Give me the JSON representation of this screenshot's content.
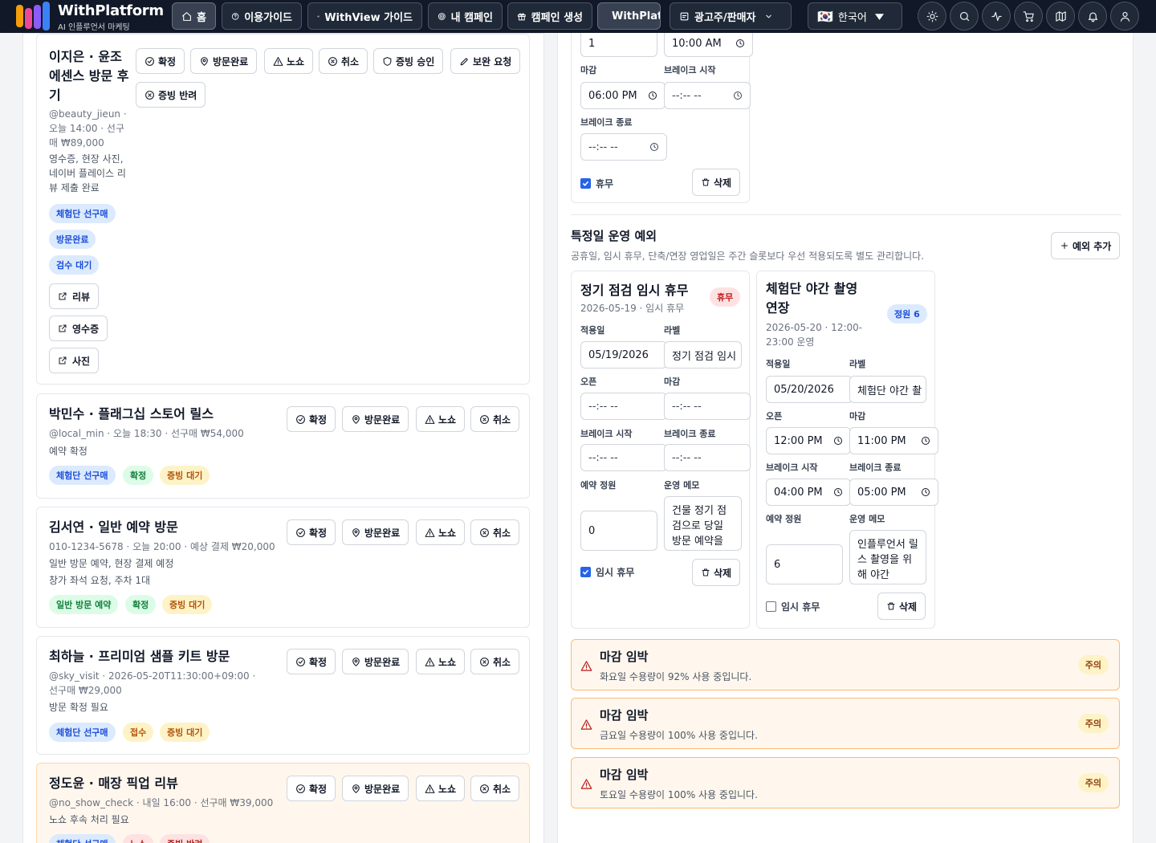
{
  "nav": {
    "brand": "WithPlatform",
    "brand_sub": "AI 인플루언서 마케팅",
    "home": "홈",
    "guide": "이용가이드",
    "withview_guide": "WithView 가이드",
    "my_campaigns": "내 캠페인",
    "create_campaign": "캠페인 생성",
    "withplatform": "WithPlatform",
    "advertiser": "광고주/판매자",
    "language": "한국어",
    "flag": "🇰🇷"
  },
  "left": {
    "cards": [
      {
        "title": "이지은 · 윤조에센스 방문 후기",
        "meta": "@beauty_jieun · 오늘 14:00 · 선구매 ₩89,000",
        "note": "영수증, 현장 사진, 네이버 플레이스 리뷰 제출 완료",
        "actions": [
          "확정",
          "방문완료",
          "노쇼",
          "취소",
          "증빙 승인",
          "보완 요청",
          "증빙 반려"
        ],
        "badges": [
          "체험단 선구매",
          "방문완료",
          "검수 대기"
        ],
        "links": [
          "리뷰",
          "영수증",
          "사진"
        ]
      },
      {
        "title": "박민수 · 플래그십 스토어 릴스",
        "meta": "@local_min · 오늘 18:30 · 선구매 ₩54,000",
        "note": "예약 확정",
        "actions": [
          "확정",
          "방문완료",
          "노쇼",
          "취소"
        ],
        "badges": [
          "체험단 선구매",
          "확정",
          "증빙 대기"
        ]
      },
      {
        "title": "김서연 · 일반 예약 방문",
        "meta": "010-1234-5678 · 오늘 20:00 · 예상 결제 ₩20,000",
        "note": "일반 방문 예약, 현장 결제 예정",
        "note2": "창가 좌석 요청, 주차 1대",
        "actions": [
          "확정",
          "방문완료",
          "노쇼",
          "취소"
        ],
        "badges": [
          "일반 방문 예약",
          "확정",
          "증빙 대기"
        ]
      },
      {
        "title": "최하늘 · 프리미엄 샘플 키트 방문",
        "meta": "@sky_visit · 2026-05-20T11:30:00+09:00 · 선구매 ₩29,000",
        "note": "방문 확정 필요",
        "actions": [
          "확정",
          "방문완료",
          "노쇼",
          "취소"
        ],
        "badges": [
          "체험단 선구매",
          "접수",
          "증빙 대기"
        ]
      },
      {
        "title": "정도윤 · 매장 픽업 리뷰",
        "meta": "@no_show_check · 내일 16:00 · 선구매 ₩39,000",
        "note": "노쇼 후속 처리 필요",
        "actions": [
          "확정",
          "방문완료",
          "노쇼",
          "취소"
        ],
        "badges": [
          "체험단 선구매",
          "노쇼",
          "증빙 반려"
        ]
      }
    ]
  },
  "right": {
    "weekly": {
      "capacity": "1",
      "open": "10:00 AM",
      "close_label": "마감",
      "close": "06:00 PM",
      "break_start_label": "브레이크 시작",
      "break_start": "--:-- --",
      "break_end_label": "브레이크 종료",
      "break_end": "--:-- --",
      "closed_label": "휴무",
      "delete": "삭제"
    },
    "exceptions": {
      "title": "특정일 운영 예외",
      "desc": "공휴일, 임시 휴무, 단축/연장 영업일은 주간 슬롯보다 우선 적용되도록 별도 관리합니다.",
      "add": "예외 추가",
      "labels": {
        "date": "적용일",
        "label": "라벨",
        "open": "오픈",
        "close": "마감",
        "break_start": "브레이크 시작",
        "break_end": "브레이크 종료",
        "capacity": "예약 정원",
        "memo": "운영 메모",
        "temp_closed": "임시 휴무",
        "delete": "삭제"
      },
      "items": [
        {
          "title": "정기 점검 임시 휴무",
          "sub": "2026-05-19 · 임시 휴무",
          "badge": "휴무",
          "date": "05/19/2026",
          "label_value": "정기 점검 임시",
          "open": "--:-- --",
          "close": "--:-- --",
          "break_start": "--:-- --",
          "break_end": "--:-- --",
          "capacity": "0",
          "memo": "건물 정기 점검으로 당일 방문 예약을",
          "temp_closed": true
        },
        {
          "title": "체험단 야간 촬영 연장",
          "sub": "2026-05-20 · 12:00-23:00 운영",
          "badge": "정원 6",
          "date": "05/20/2026",
          "label_value": "체험단 야간 촬",
          "open": "12:00 PM",
          "close": "11:00 PM",
          "break_start": "04:00 PM",
          "break_end": "05:00 PM",
          "capacity": "6",
          "memo": "인플루언서 릴스 촬영을 위해 야간",
          "temp_closed": false
        }
      ]
    },
    "alerts": [
      {
        "title": "마감 임박",
        "message": "화요일 수용량이 92% 사용 중입니다.",
        "severity": "주의"
      },
      {
        "title": "마감 임박",
        "message": "금요일 수용량이 100% 사용 중입니다.",
        "severity": "주의"
      },
      {
        "title": "마감 임박",
        "message": "토요일 수용량이 100% 사용 중입니다.",
        "severity": "주의"
      }
    ]
  }
}
